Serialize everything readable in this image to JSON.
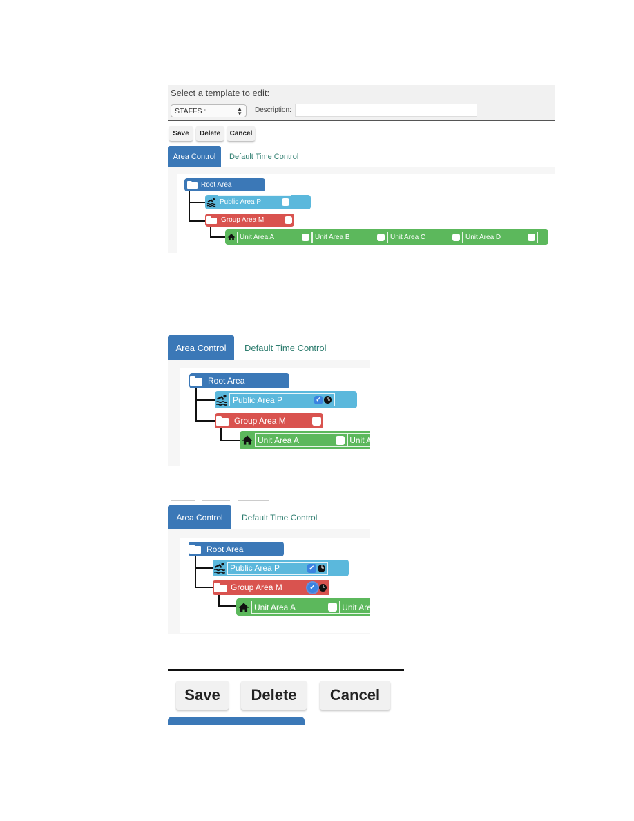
{
  "template_editor": {
    "title": "Select a template to edit:",
    "template_select": {
      "selected": "STAFFS :"
    },
    "description_label": "Description:",
    "description_value": "",
    "buttons": {
      "save": "Save",
      "delete": "Delete",
      "cancel": "Cancel"
    },
    "tabs": [
      {
        "label": "Area Control",
        "active": true
      },
      {
        "label": "Default Time Control",
        "active": false
      }
    ]
  },
  "area_tree": {
    "root": {
      "label": "Root Area",
      "icon": "folder-icon"
    },
    "public": {
      "label": "Public Area P",
      "icon": "swimming-icon"
    },
    "group": {
      "label": "Group Area M",
      "icon": "folder-icon"
    },
    "units": {
      "icon": "home-icon",
      "items": [
        {
          "label": "Unit Area A",
          "checked": false
        },
        {
          "label": "Unit Area B",
          "checked": false
        },
        {
          "label": "Unit Area C",
          "checked": false
        },
        {
          "label": "Unit Area D",
          "checked": false
        }
      ]
    }
  },
  "example_2": {
    "tabs": [
      {
        "label": "Area Control",
        "active": true
      },
      {
        "label": "Default Time Control",
        "active": false
      }
    ],
    "root": "Root Area",
    "public": {
      "label": "Public Area P",
      "checked": true,
      "time_control": "clock-icon"
    },
    "group": {
      "label": "Group Area M",
      "checked": false
    },
    "unit_a": {
      "label": "Unit Area A",
      "checked": false
    },
    "unit_b_partial": "Unit A"
  },
  "example_3": {
    "tabs": [
      {
        "label": "Area Control",
        "active": true
      },
      {
        "label": "Default Time Control",
        "active": false
      }
    ],
    "root": "Root Area",
    "public": {
      "label": "Public Area P",
      "checked": true,
      "time_control": "clock-icon"
    },
    "group": {
      "label": "Group Area M",
      "checked": true,
      "time_control": "clock-icon"
    },
    "unit_a": {
      "label": "Unit Area A",
      "checked": false
    },
    "unit_b_partial": "Unit Are"
  },
  "button_zoom": {
    "save": "Save",
    "delete": "Delete",
    "cancel": "Cancel"
  },
  "colors": {
    "root": "#3b78b7",
    "public": "#5bb8dc",
    "group": "#d9534f",
    "unit": "#5cb85c",
    "tab_active": "#3b78b7",
    "tab_inactive_text": "#2e7d6f",
    "checkbox_on": "#3b83e0"
  }
}
